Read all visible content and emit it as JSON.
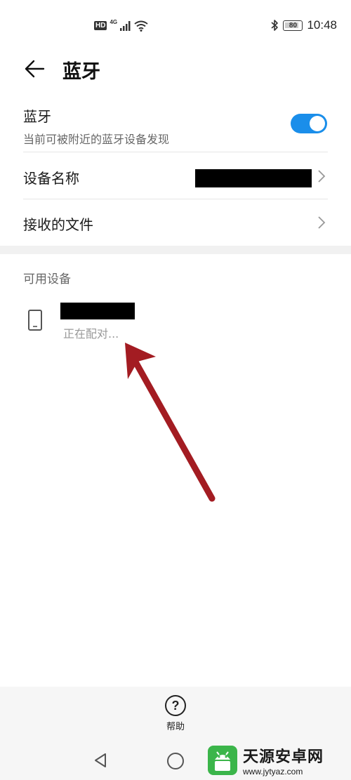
{
  "status_bar": {
    "hd": "HD",
    "network": "4G",
    "battery": "80",
    "time": "10:48",
    "icons": [
      "signal-icon",
      "wifi-icon",
      "bluetooth-icon",
      "battery-icon"
    ]
  },
  "header": {
    "title": "蓝牙",
    "back_icon": "arrow-left-icon"
  },
  "bluetooth_row": {
    "title": "蓝牙",
    "subtitle": "当前可被附近的蓝牙设备发现",
    "toggle_on": true
  },
  "device_name_row": {
    "title": "设备名称"
  },
  "received_files_row": {
    "title": "接收的文件"
  },
  "available_devices": {
    "section_label": "可用设备",
    "items": [
      {
        "status": "正在配对..."
      }
    ]
  },
  "bottom": {
    "help_label": "帮助"
  },
  "watermark": {
    "name": "天源安卓网",
    "url": "www.jytyaz.com"
  },
  "colors": {
    "accent": "#1a8eea",
    "arrow": "#a31c22",
    "watermark_green": "#3bb54a"
  }
}
